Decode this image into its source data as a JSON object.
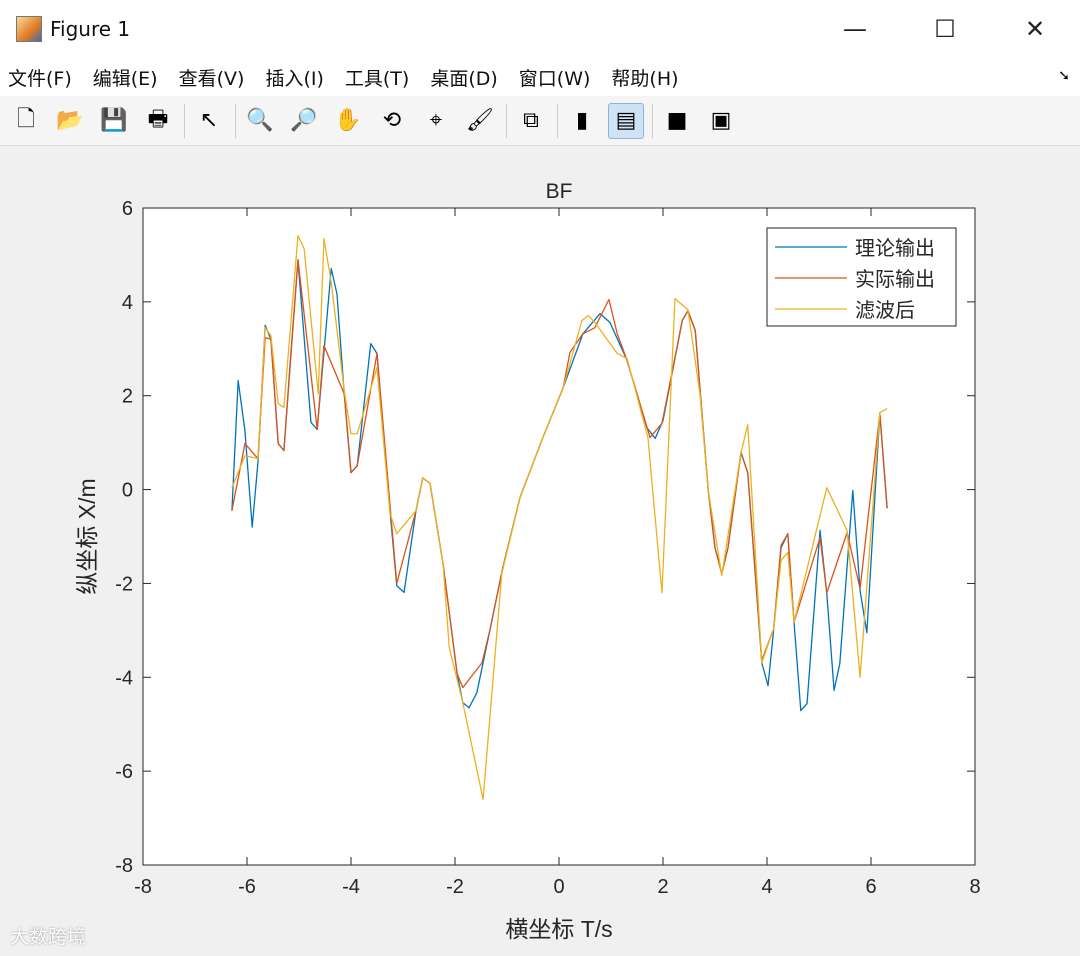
{
  "window": {
    "title": "Figure 1",
    "minimize": "—",
    "maximize": "☐",
    "close": "✕"
  },
  "menu": [
    "文件(F)",
    "编辑(E)",
    "查看(V)",
    "插入(I)",
    "工具(T)",
    "桌面(D)",
    "窗口(W)",
    "帮助(H)"
  ],
  "toolbar": [
    {
      "name": "new-figure-icon",
      "glyph": "🗋"
    },
    {
      "name": "open-icon",
      "glyph": "📂"
    },
    {
      "name": "save-icon",
      "glyph": "💾"
    },
    {
      "name": "print-icon",
      "glyph": "🖶"
    },
    {
      "sep": true
    },
    {
      "name": "pointer-icon",
      "glyph": "↖"
    },
    {
      "sep": true
    },
    {
      "name": "zoom-in-icon",
      "glyph": "🔍"
    },
    {
      "name": "zoom-out-icon",
      "glyph": "🔎"
    },
    {
      "name": "pan-icon",
      "glyph": "✋"
    },
    {
      "name": "rotate-icon",
      "glyph": "⟲"
    },
    {
      "name": "data-cursor-icon",
      "glyph": "⌖"
    },
    {
      "name": "brush-icon",
      "glyph": "🖌"
    },
    {
      "sep": true
    },
    {
      "name": "link-plot-icon",
      "glyph": "⧉"
    },
    {
      "sep": true
    },
    {
      "name": "colorbar-icon",
      "glyph": "▮"
    },
    {
      "name": "legend-icon",
      "glyph": "▤",
      "active": true
    },
    {
      "sep": true
    },
    {
      "name": "hide-plot-tools-icon",
      "glyph": "■"
    },
    {
      "name": "show-plot-tools-icon",
      "glyph": "▣"
    }
  ],
  "watermark": "大数跨境",
  "chart_data": {
    "type": "line",
    "title": "BF",
    "xlabel": "横坐标 T/s",
    "ylabel": "纵坐标 X/m",
    "xlim": [
      -8,
      8
    ],
    "ylim": [
      -8,
      6
    ],
    "xticks": [
      -8,
      -6,
      -4,
      -2,
      0,
      2,
      4,
      6,
      8
    ],
    "yticks": [
      -8,
      -6,
      -4,
      -2,
      0,
      2,
      4,
      6
    ],
    "grid": false,
    "legend_position": "top-right",
    "series": [
      {
        "name": "理论输出",
        "color": "#0072BD",
        "points": [
          [
            -6.29,
            -0.45
          ],
          [
            -6.17,
            2.32
          ],
          [
            -6.04,
            1.26
          ],
          [
            -5.9,
            -0.8
          ],
          [
            -5.79,
            0.57
          ],
          [
            -5.65,
            3.5
          ],
          [
            -5.54,
            3.2
          ],
          [
            -5.4,
            0.98
          ],
          [
            -5.29,
            0.83
          ],
          [
            -5.15,
            3.0
          ],
          [
            -5.02,
            4.88
          ],
          [
            -4.77,
            1.43
          ],
          [
            -4.65,
            1.28
          ],
          [
            -4.38,
            4.71
          ],
          [
            -4.27,
            4.17
          ],
          [
            -4.13,
            2.04
          ],
          [
            -4.0,
            0.36
          ],
          [
            -3.88,
            0.51
          ],
          [
            -3.62,
            3.11
          ],
          [
            -3.5,
            2.9
          ],
          [
            -3.25,
            -0.45
          ],
          [
            -3.12,
            -2.05
          ],
          [
            -2.98,
            -2.19
          ],
          [
            -2.75,
            -0.45
          ],
          [
            -2.62,
            0.25
          ],
          [
            -2.48,
            0.13
          ],
          [
            -2.23,
            -1.58
          ],
          [
            -1.96,
            -3.92
          ],
          [
            -1.85,
            -4.54
          ],
          [
            -1.73,
            -4.65
          ],
          [
            -1.58,
            -4.33
          ],
          [
            -1.33,
            -3.0
          ],
          [
            -1.08,
            -1.66
          ],
          [
            -0.75,
            -0.17
          ],
          [
            -0.31,
            1.11
          ],
          [
            0.08,
            2.17
          ],
          [
            0.46,
            3.32
          ],
          [
            0.79,
            3.75
          ],
          [
            0.98,
            3.56
          ],
          [
            1.31,
            2.75
          ],
          [
            1.69,
            1.32
          ],
          [
            1.85,
            1.09
          ],
          [
            2.0,
            1.47
          ],
          [
            2.37,
            3.6
          ],
          [
            2.48,
            3.81
          ],
          [
            2.62,
            3.39
          ],
          [
            2.87,
            -0.02
          ],
          [
            3.0,
            -1.24
          ],
          [
            3.13,
            -1.79
          ],
          [
            3.25,
            -1.24
          ],
          [
            3.5,
            0.79
          ],
          [
            3.63,
            0.36
          ],
          [
            3.9,
            -3.69
          ],
          [
            4.02,
            -4.18
          ],
          [
            4.13,
            -2.96
          ],
          [
            4.27,
            -1.24
          ],
          [
            4.4,
            -0.94
          ],
          [
            4.52,
            -2.83
          ],
          [
            4.65,
            -4.71
          ],
          [
            4.77,
            -4.56
          ],
          [
            5.02,
            -0.87
          ],
          [
            5.15,
            -2.22
          ],
          [
            5.29,
            -4.28
          ],
          [
            5.4,
            -3.71
          ],
          [
            5.65,
            -0.02
          ],
          [
            5.79,
            -2.15
          ],
          [
            5.92,
            -3.05
          ],
          [
            6.17,
            1.62
          ],
          [
            6.31,
            -0.4
          ]
        ]
      },
      {
        "name": "实际输出",
        "color": "#D95319",
        "points": [
          [
            -6.29,
            -0.45
          ],
          [
            -6.04,
            0.98
          ],
          [
            -5.79,
            0.66
          ],
          [
            -5.65,
            3.24
          ],
          [
            -5.54,
            3.2
          ],
          [
            -5.4,
            0.98
          ],
          [
            -5.29,
            0.83
          ],
          [
            -5.02,
            4.9
          ],
          [
            -4.65,
            1.28
          ],
          [
            -4.52,
            3.07
          ],
          [
            -4.13,
            2.04
          ],
          [
            -4.0,
            0.36
          ],
          [
            -3.88,
            0.51
          ],
          [
            -3.5,
            2.9
          ],
          [
            -3.12,
            -2.0
          ],
          [
            -2.75,
            -0.45
          ],
          [
            -2.62,
            0.25
          ],
          [
            -2.48,
            0.13
          ],
          [
            -2.23,
            -1.58
          ],
          [
            -1.96,
            -3.92
          ],
          [
            -1.85,
            -4.22
          ],
          [
            -1.48,
            -3.69
          ],
          [
            -1.33,
            -3.0
          ],
          [
            -1.08,
            -1.66
          ],
          [
            -0.75,
            -0.17
          ],
          [
            -0.31,
            1.11
          ],
          [
            0.08,
            2.17
          ],
          [
            0.21,
            2.92
          ],
          [
            0.46,
            3.32
          ],
          [
            0.69,
            3.45
          ],
          [
            0.96,
            4.05
          ],
          [
            1.12,
            3.32
          ],
          [
            1.31,
            2.75
          ],
          [
            1.75,
            1.11
          ],
          [
            1.98,
            1.41
          ],
          [
            2.37,
            3.6
          ],
          [
            2.48,
            3.81
          ],
          [
            2.62,
            3.39
          ],
          [
            2.87,
            -0.02
          ],
          [
            3.0,
            -1.24
          ],
          [
            3.13,
            -1.79
          ],
          [
            3.25,
            -1.24
          ],
          [
            3.5,
            0.79
          ],
          [
            3.63,
            0.36
          ],
          [
            3.9,
            -3.64
          ],
          [
            4.13,
            -2.96
          ],
          [
            4.27,
            -1.19
          ],
          [
            4.4,
            -0.94
          ],
          [
            4.52,
            -2.83
          ],
          [
            5.02,
            -1.02
          ],
          [
            5.15,
            -2.2
          ],
          [
            5.54,
            -0.92
          ],
          [
            5.79,
            -2.11
          ],
          [
            6.17,
            1.62
          ],
          [
            6.31,
            -0.4
          ]
        ]
      },
      {
        "name": "滤波后",
        "color": "#EDB120",
        "points": [
          [
            -6.29,
            0.04
          ],
          [
            -6.04,
            0.72
          ],
          [
            -5.79,
            0.66
          ],
          [
            -5.65,
            3.45
          ],
          [
            -5.54,
            3.28
          ],
          [
            -5.4,
            1.83
          ],
          [
            -5.29,
            1.75
          ],
          [
            -5.02,
            5.41
          ],
          [
            -4.9,
            5.13
          ],
          [
            -4.63,
            2.04
          ],
          [
            -4.52,
            5.35
          ],
          [
            -4.38,
            4.41
          ],
          [
            -4.13,
            2.11
          ],
          [
            -4.0,
            1.19
          ],
          [
            -3.88,
            1.19
          ],
          [
            -3.5,
            2.6
          ],
          [
            -3.25,
            -0.51
          ],
          [
            -3.12,
            -0.94
          ],
          [
            -2.75,
            -0.45
          ],
          [
            -2.62,
            0.25
          ],
          [
            -2.48,
            0.13
          ],
          [
            -2.23,
            -1.58
          ],
          [
            -2.11,
            -3.37
          ],
          [
            -1.85,
            -4.54
          ],
          [
            -1.46,
            -6.6
          ],
          [
            -1.1,
            -1.79
          ],
          [
            -0.75,
            -0.17
          ],
          [
            -0.31,
            1.11
          ],
          [
            0.08,
            2.17
          ],
          [
            0.44,
            3.6
          ],
          [
            0.56,
            3.71
          ],
          [
            0.69,
            3.56
          ],
          [
            1.12,
            2.9
          ],
          [
            1.31,
            2.79
          ],
          [
            1.71,
            1.11
          ],
          [
            1.98,
            -2.2
          ],
          [
            2.23,
            4.07
          ],
          [
            2.48,
            3.83
          ],
          [
            2.71,
            2.04
          ],
          [
            2.87,
            -0.02
          ],
          [
            3.13,
            -1.83
          ],
          [
            3.5,
            0.79
          ],
          [
            3.63,
            1.38
          ],
          [
            3.9,
            -3.69
          ],
          [
            4.13,
            -2.96
          ],
          [
            4.27,
            -1.51
          ],
          [
            4.4,
            -1.34
          ],
          [
            4.52,
            -2.83
          ],
          [
            5.15,
            0.04
          ],
          [
            5.54,
            -0.87
          ],
          [
            5.79,
            -4.0
          ],
          [
            6.17,
            1.64
          ],
          [
            6.31,
            1.73
          ]
        ]
      }
    ]
  }
}
